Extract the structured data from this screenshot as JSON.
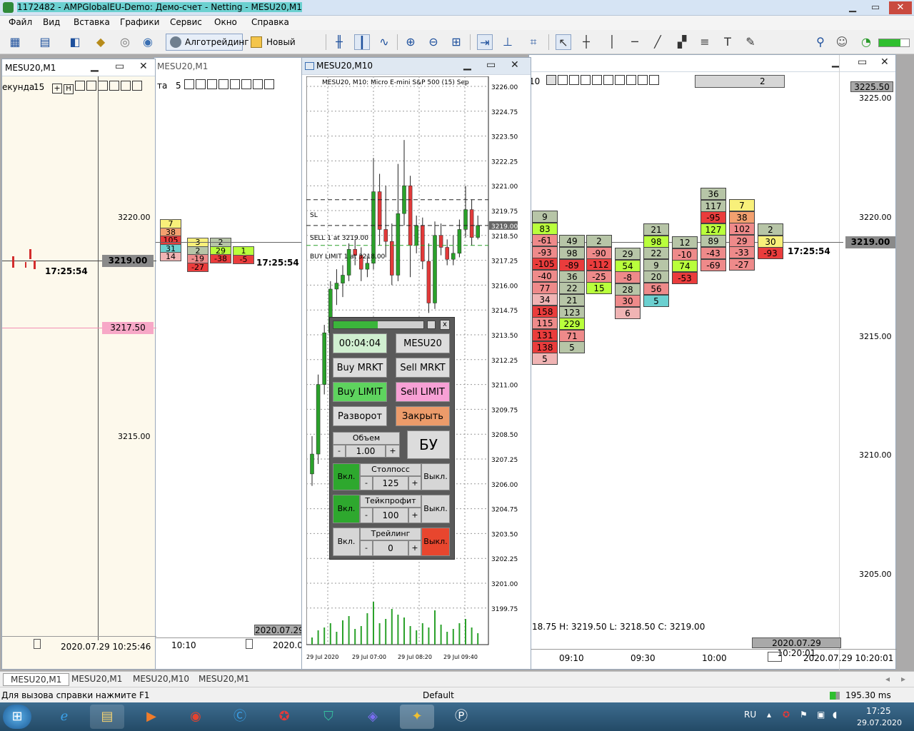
{
  "app": {
    "title": "1172482 - AMPGlobalEU-Demo: Демо-счет - Netting - MESU20,M1",
    "min": "▁",
    "max": "▭",
    "close": "✕"
  },
  "menu": [
    "Файл",
    "Вид",
    "Вставка",
    "Графики",
    "Сервис",
    "Окно",
    "Справка"
  ],
  "toolbar": {
    "algo": "Алготрейдинг",
    "new_order": "Новый ордер"
  },
  "win_left": {
    "title": "MESU20,M1",
    "period_label": "екунда",
    "period": "15",
    "price_high": "3220.00",
    "price_low": "3215.00",
    "current_price": "3219.00",
    "pink_price": "3217.50",
    "time": "17:25:54",
    "date": "2020.07.29 10:25:46",
    "other_time": "10:10",
    "other_date": "2020.07.29",
    "flag": "та",
    "flag_n": "5",
    "cur_time2": "17:25:54"
  },
  "win_mid": {
    "title": "MESU20,M10",
    "chart_title": "MESU20, M10:  Micro E-mini S&P 500 (15) Sep",
    "sl": "SL",
    "sell_line": "SELL 1 at 3219.00",
    "buy_line": "BUY LIMIT 1 at 3218.00",
    "price_badge": "3219.00",
    "prices": [
      "3226.00",
      "3224.75",
      "3223.50",
      "3222.25",
      "3221.00",
      "3219.75",
      "3218.50",
      "3217.25",
      "3216.00",
      "3214.75",
      "3213.50",
      "3212.25",
      "3211.00",
      "3209.75",
      "3208.50",
      "3207.25",
      "3206.00",
      "3204.75",
      "3203.50",
      "3202.25",
      "3201.00",
      "3199.75"
    ],
    "dates": [
      "29 Jul 2020",
      "29 Jul 07:00",
      "29 Jul 08:20",
      "29 Jul 09:40"
    ]
  },
  "panel": {
    "timer": "00:04:04",
    "symbol": "MESU20",
    "buy_mkt": "Buy MRKT",
    "sell_mkt": "Sell MRKT",
    "buy_limit": "Buy LIMIT",
    "sell_limit": "Sell LIMIT",
    "reverse": "Разворот",
    "close": "Закрыть",
    "volume_label": "Объем",
    "volume": "1.00",
    "minus": "-",
    "plus": "+",
    "bu": "БУ",
    "on": "Вкл.",
    "off": "Выкл.",
    "sl_label": "Столпосс",
    "sl_value": "125",
    "tp_label": "Тейкпрофит",
    "tp_value": "100",
    "trail_label": "Трейлинг",
    "trail_value": "0",
    "x": "x"
  },
  "win_right": {
    "period": "10",
    "spin": "2",
    "ask": "3225.50",
    "prices": [
      "3225.00",
      "3220.00",
      "3215.00",
      "3210.00",
      "3205.00"
    ],
    "current_price": "3219.00",
    "time": "17:25:54",
    "ohlc": "18.75  H: 3219.50  L: 3218.50  C: 3219.00",
    "date_top": "2020.07.29 10:20:01",
    "times": [
      "09:10",
      "09:30",
      "10:00"
    ],
    "date_bottom": "2020.07.29 10:20:01"
  },
  "tabs": [
    "MESU20,M1",
    "MESU20,M1",
    "MESU20,M10",
    "MESU20,M1"
  ],
  "status": {
    "help": "Для вызова справки нажмите F1",
    "profile": "Default",
    "ping": "195.30 ms"
  },
  "tray": {
    "lang": "RU",
    "time": "17:25",
    "date": "29.07.2020"
  }
}
